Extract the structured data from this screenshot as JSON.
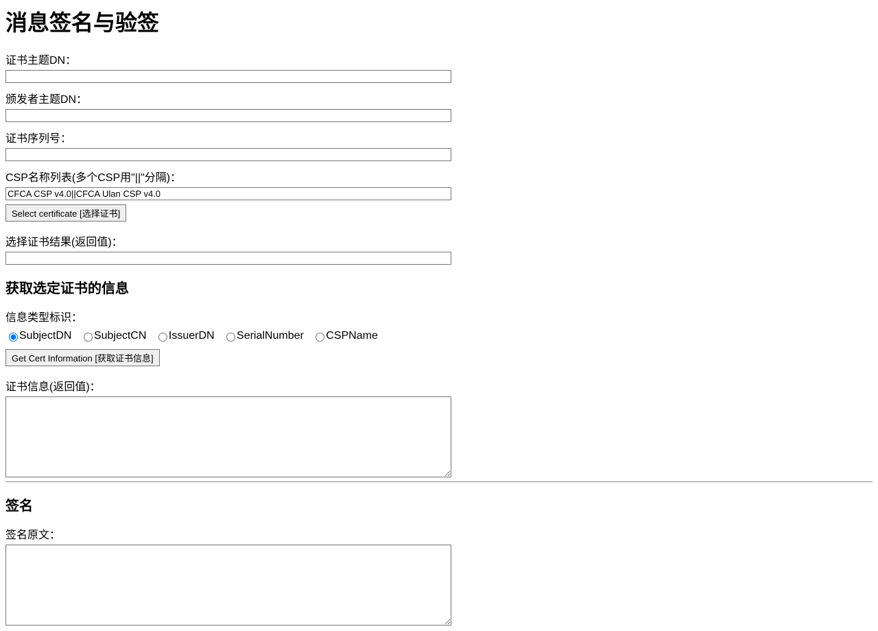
{
  "page_title": "消息签名与验签",
  "fields": {
    "cert_subject_dn_label": "证书主题DN：",
    "cert_subject_dn_value": "",
    "issuer_subject_dn_label": "颁发者主题DN：",
    "issuer_subject_dn_value": "",
    "cert_serial_label": "证书序列号：",
    "cert_serial_value": "",
    "csp_list_label": "CSP名称列表(多个CSP用\"||\"分隔)：",
    "csp_list_value": "CFCA CSP v4.0||CFCA Ulan CSP v4.0",
    "select_cert_button": "Select certificate [选择证书]",
    "select_cert_result_label": "选择证书结果(返回值)：",
    "select_cert_result_value": ""
  },
  "cert_info_section": {
    "heading": "获取选定证书的信息",
    "info_type_label": "信息类型标识：",
    "radios": {
      "subject_dn": "SubjectDN",
      "subject_cn": "SubjectCN",
      "issuer_dn": "IssuerDN",
      "serial_number": "SerialNumber",
      "csp_name": "CSPName"
    },
    "get_cert_info_button": "Get Cert Information [获取证书信息]",
    "cert_info_result_label": "证书信息(返回值)：",
    "cert_info_result_value": ""
  },
  "sign_section": {
    "heading": "签名",
    "sign_source_label": "签名原文：",
    "sign_source_value": ""
  }
}
